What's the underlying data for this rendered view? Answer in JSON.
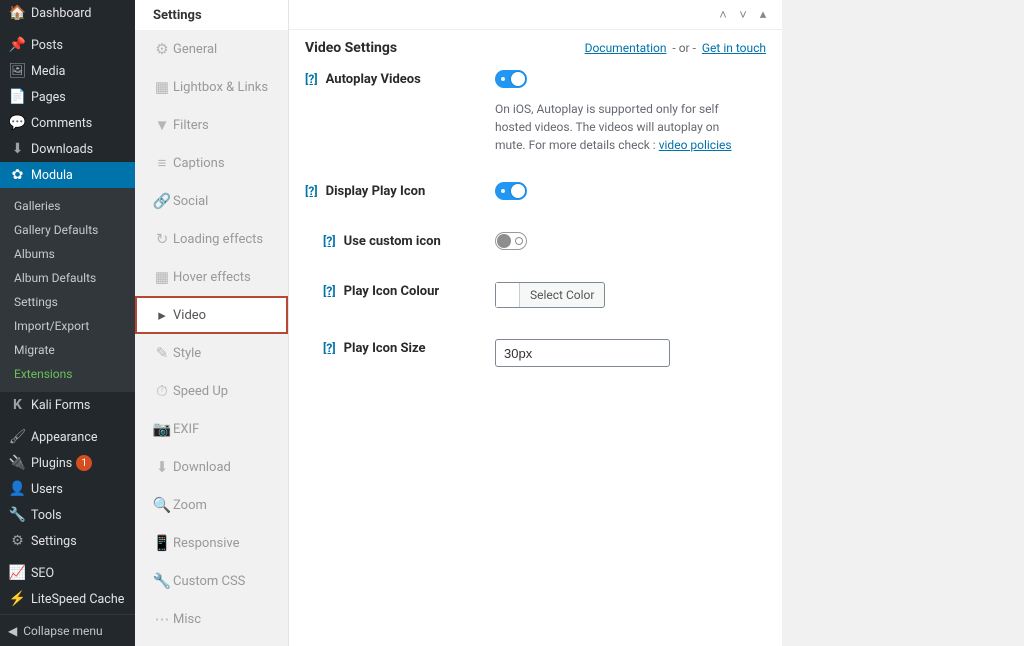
{
  "admin_menu": {
    "items": [
      {
        "icon": "🏠",
        "label": "Dashboard"
      },
      {
        "icon": "📌",
        "label": "Posts"
      },
      {
        "icon": "🖼",
        "label": "Media"
      },
      {
        "icon": "📄",
        "label": "Pages"
      },
      {
        "icon": "💬",
        "label": "Comments"
      },
      {
        "icon": "⬇",
        "label": "Downloads"
      },
      {
        "icon": "✿",
        "label": "Modula"
      }
    ],
    "submenu": [
      "Galleries",
      "Gallery Defaults",
      "Albums",
      "Album Defaults",
      "Settings",
      "Import/Export",
      "Migrate",
      "Extensions"
    ],
    "items2": [
      {
        "icon": "K",
        "label": "Kali Forms"
      },
      {
        "icon": "🖌",
        "label": "Appearance"
      },
      {
        "icon": "🔌",
        "label": "Plugins",
        "badge": "1"
      },
      {
        "icon": "👤",
        "label": "Users"
      },
      {
        "icon": "🔧",
        "label": "Tools"
      },
      {
        "icon": "⚙",
        "label": "Settings"
      },
      {
        "icon": "📈",
        "label": "SEO"
      },
      {
        "icon": "⚡",
        "label": "LiteSpeed Cache"
      }
    ],
    "collapse": "Collapse menu"
  },
  "settings_tabs": {
    "panel_title": "Settings",
    "tabs": [
      {
        "icon": "⚙",
        "label": "General"
      },
      {
        "icon": "▦",
        "label": "Lightbox & Links"
      },
      {
        "icon": "▼",
        "label": "Filters"
      },
      {
        "icon": "≡",
        "label": "Captions"
      },
      {
        "icon": "🔗",
        "label": "Social"
      },
      {
        "icon": "↻",
        "label": "Loading effects"
      },
      {
        "icon": "▦",
        "label": "Hover effects"
      },
      {
        "icon": "▸",
        "label": "Video"
      },
      {
        "icon": "✎",
        "label": "Style"
      },
      {
        "icon": "⏱",
        "label": "Speed Up"
      },
      {
        "icon": "📷",
        "label": "EXIF"
      },
      {
        "icon": "⬇",
        "label": "Download"
      },
      {
        "icon": "🔍",
        "label": "Zoom"
      },
      {
        "icon": "📱",
        "label": "Responsive"
      },
      {
        "icon": "🔧",
        "label": "Custom CSS"
      },
      {
        "icon": "⋯",
        "label": "Misc"
      }
    ]
  },
  "main": {
    "title": "Video Settings",
    "doc_link": "Documentation",
    "or_text": "- or -",
    "contact_link": "Get in touch",
    "help_q": "[?]",
    "settings": {
      "autoplay": {
        "label": "Autoplay Videos",
        "desc_pre": "On iOS, Autoplay is supported only for self hosted videos. The videos will autoplay on mute. For more details check : ",
        "desc_link": "video policies"
      },
      "display_icon": {
        "label": "Display Play Icon"
      },
      "custom_icon": {
        "label": "Use custom icon"
      },
      "icon_colour": {
        "label": "Play Icon Colour",
        "btn": "Select Color"
      },
      "icon_size": {
        "label": "Play Icon Size",
        "value": "30px"
      }
    }
  }
}
